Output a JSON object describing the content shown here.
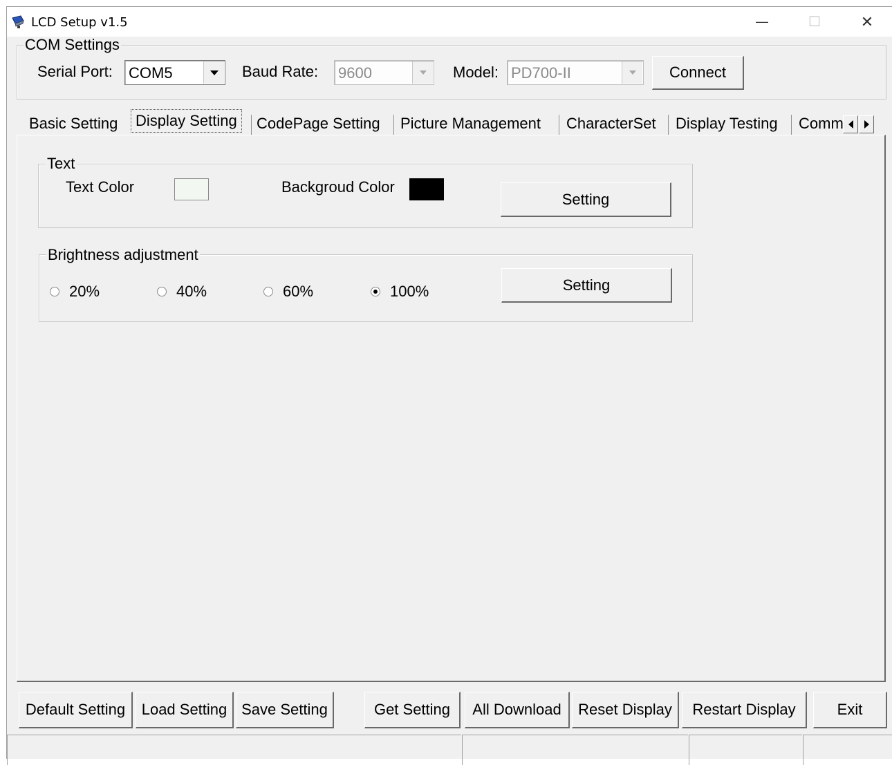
{
  "window": {
    "title": "LCD Setup v1.5",
    "controls": {
      "minimize": "—",
      "maximize": "☐",
      "close": "✕"
    }
  },
  "com_settings": {
    "legend": "COM Settings",
    "serial_port_label": "Serial Port:",
    "serial_port_value": "COM5",
    "baud_rate_label": "Baud Rate:",
    "baud_rate_value": "9600",
    "model_label": "Model:",
    "model_value": "PD700-II",
    "connect_label": "Connect"
  },
  "tabs": [
    {
      "label": "Basic Setting"
    },
    {
      "label": "Display Setting"
    },
    {
      "label": "CodePage Setting"
    },
    {
      "label": "Picture Management"
    },
    {
      "label": "CharacterSet"
    },
    {
      "label": "Display Testing"
    },
    {
      "label": "Comm"
    }
  ],
  "active_tab": "Display Setting",
  "text_group": {
    "legend": "Text",
    "text_color_label": "Text Color",
    "text_color": "#f2f7f2",
    "background_color_label": "Backgroud Color",
    "background_color": "#000000",
    "setting_label": "Setting"
  },
  "brightness_group": {
    "legend": "Brightness adjustment",
    "options": [
      {
        "label": "20%",
        "checked": false
      },
      {
        "label": "40%",
        "checked": false
      },
      {
        "label": "60%",
        "checked": false
      },
      {
        "label": "100%",
        "checked": true
      }
    ],
    "setting_label": "Setting"
  },
  "bottom_buttons": {
    "default_setting": "Default Setting",
    "load_setting": "Load Setting",
    "save_setting": "Save Setting",
    "get_setting": "Get Setting",
    "all_download": "All Download",
    "reset_display": "Reset Display",
    "restart_display": "Restart Display",
    "exit": "Exit"
  }
}
